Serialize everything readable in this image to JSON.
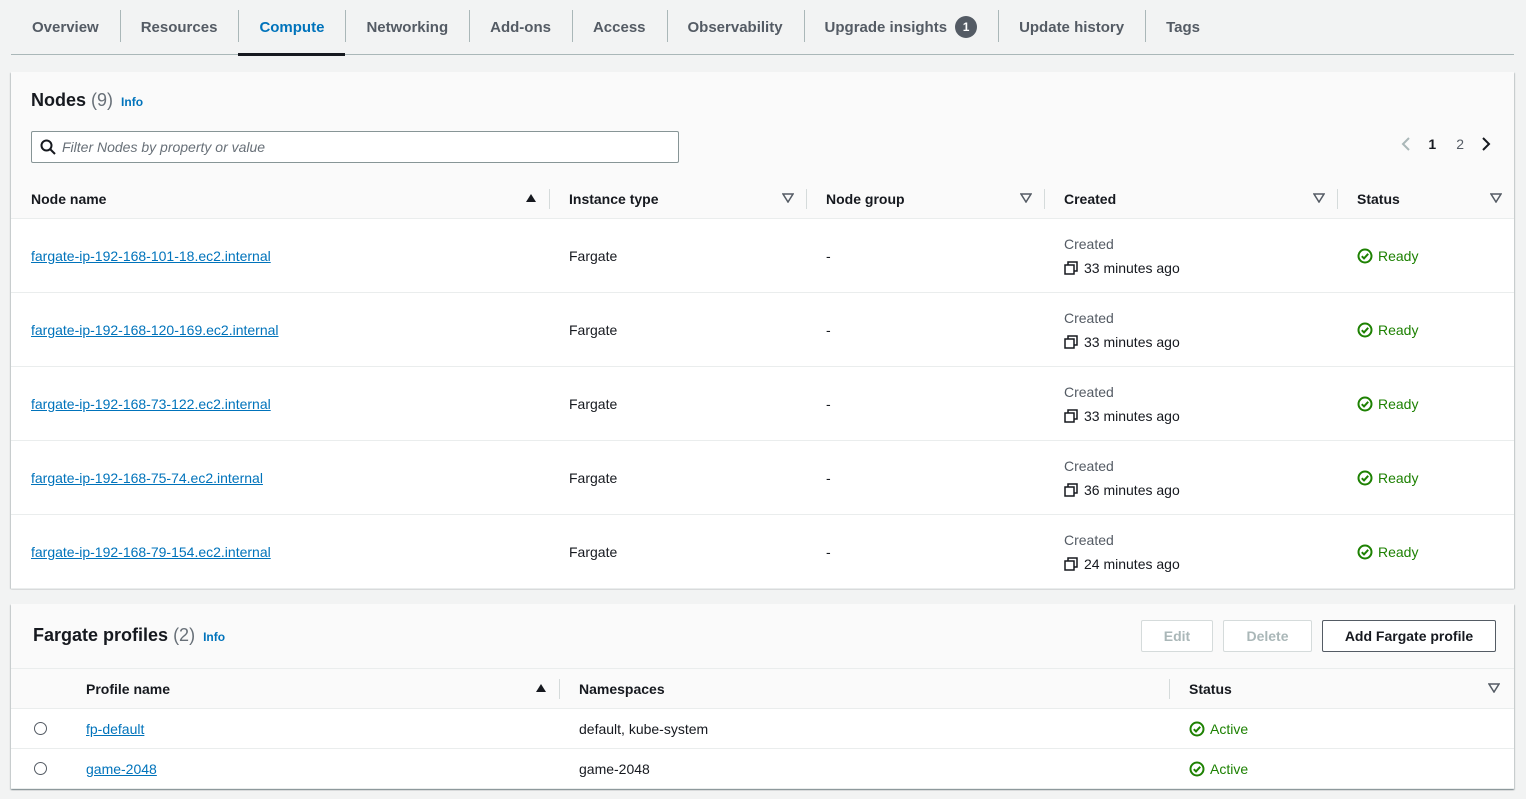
{
  "tabs": [
    {
      "label": "Overview",
      "active": false
    },
    {
      "label": "Resources",
      "active": false
    },
    {
      "label": "Compute",
      "active": true
    },
    {
      "label": "Networking",
      "active": false
    },
    {
      "label": "Add-ons",
      "active": false
    },
    {
      "label": "Access",
      "active": false
    },
    {
      "label": "Observability",
      "active": false
    },
    {
      "label": "Upgrade insights",
      "active": false,
      "badge": "1"
    },
    {
      "label": "Update history",
      "active": false
    },
    {
      "label": "Tags",
      "active": false
    }
  ],
  "nodes": {
    "title": "Nodes",
    "count": "(9)",
    "info": "Info",
    "filter_placeholder": "Filter Nodes by property or value",
    "pages": [
      "1",
      "2"
    ],
    "current_page": "1",
    "columns": [
      "Node name",
      "Instance type",
      "Node group",
      "Created",
      "Status"
    ],
    "rows": [
      {
        "name": "fargate-ip-192-168-101-18.ec2.internal",
        "instance": "Fargate",
        "group": "-",
        "created_label": "Created",
        "created": "33 minutes ago",
        "status": "Ready"
      },
      {
        "name": "fargate-ip-192-168-120-169.ec2.internal",
        "instance": "Fargate",
        "group": "-",
        "created_label": "Created",
        "created": "33 minutes ago",
        "status": "Ready"
      },
      {
        "name": "fargate-ip-192-168-73-122.ec2.internal",
        "instance": "Fargate",
        "group": "-",
        "created_label": "Created",
        "created": "33 minutes ago",
        "status": "Ready"
      },
      {
        "name": "fargate-ip-192-168-75-74.ec2.internal",
        "instance": "Fargate",
        "group": "-",
        "created_label": "Created",
        "created": "36 minutes ago",
        "status": "Ready"
      },
      {
        "name": "fargate-ip-192-168-79-154.ec2.internal",
        "instance": "Fargate",
        "group": "-",
        "created_label": "Created",
        "created": "24 minutes ago",
        "status": "Ready"
      }
    ]
  },
  "profiles": {
    "title": "Fargate profiles",
    "count": "(2)",
    "info": "Info",
    "edit": "Edit",
    "delete": "Delete",
    "add": "Add Fargate profile",
    "columns": [
      "Profile name",
      "Namespaces",
      "Status"
    ],
    "rows": [
      {
        "name": "fp-default",
        "namespaces": "default, kube-system",
        "status": "Active"
      },
      {
        "name": "game-2048",
        "namespaces": "game-2048",
        "status": "Active"
      }
    ]
  },
  "colors": {
    "link": "#0073bb",
    "success": "#1d8102"
  }
}
